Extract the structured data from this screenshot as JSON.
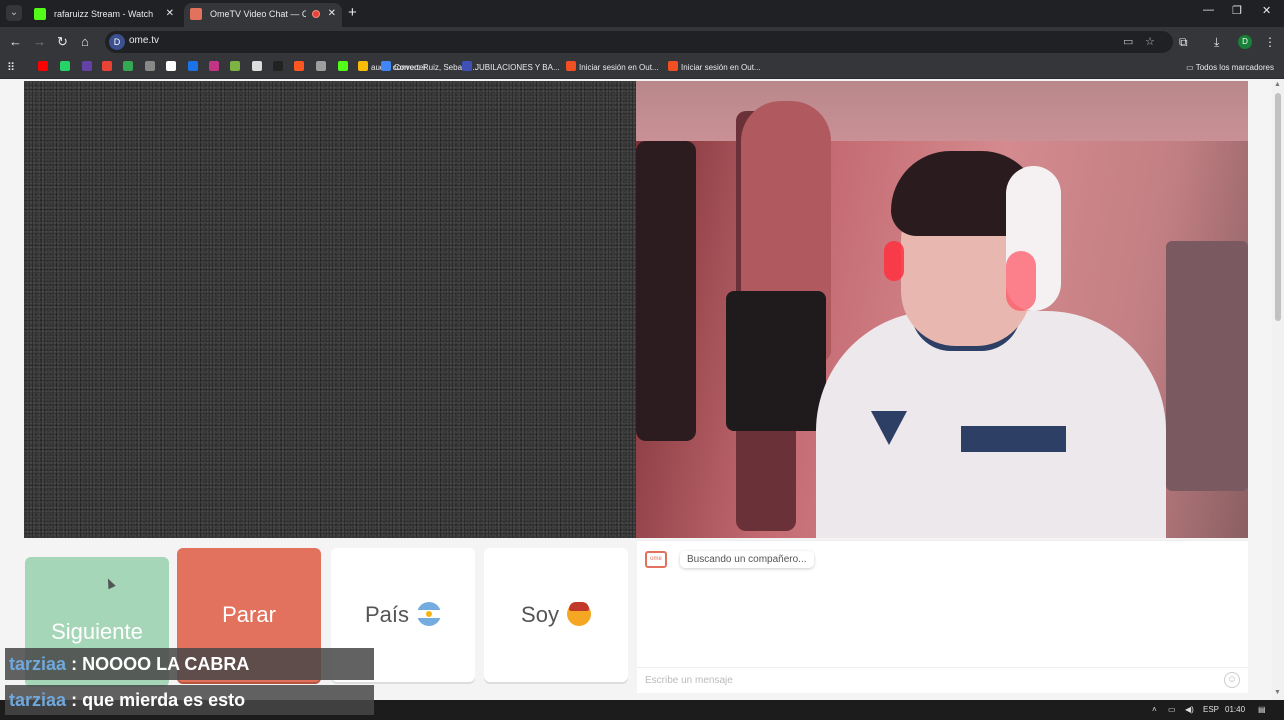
{
  "browser": {
    "tabs": [
      {
        "title": "rafaruizz Stream - Watch Live o",
        "favicon_color": "#53fc18",
        "active": false
      },
      {
        "title": "OmeTV Video Chat — Ome",
        "favicon_color": "#e2725e",
        "active": true
      }
    ],
    "url": "ome.tv",
    "site_badge": "D",
    "profile_initial": "D",
    "bookmarks": [
      {
        "label": "",
        "color": "#ff0000"
      },
      {
        "label": "",
        "color": "#25d366"
      },
      {
        "label": "",
        "color": "#6441a5"
      },
      {
        "label": "",
        "color": "#ea4335"
      },
      {
        "label": "",
        "color": "#34a853"
      },
      {
        "label": "",
        "color": "#888888"
      },
      {
        "label": "",
        "color": "#ffffff"
      },
      {
        "label": "",
        "color": "#1a73e8"
      },
      {
        "label": "",
        "color": "#c13584"
      },
      {
        "label": "",
        "color": "#7cb342"
      },
      {
        "label": "",
        "color": "#dddddd"
      },
      {
        "label": "",
        "color": "#222222"
      },
      {
        "label": "",
        "color": "#ff5722"
      },
      {
        "label": "",
        "color": "#9e9e9e"
      },
      {
        "label": "",
        "color": "#53fc18"
      },
      {
        "label": "audio converter",
        "color": "#fbbc05"
      },
      {
        "label": "Correo: Ruiz, Sebasti...",
        "color": "#4285f4"
      },
      {
        "label": "JUBILACIONES Y BA...",
        "color": "#3f51b5"
      },
      {
        "label": "Iniciar sesión en Out...",
        "color": "#f25022"
      },
      {
        "label": "Iniciar sesión en Out...",
        "color": "#f25022"
      }
    ],
    "all_bookmarks": "Todos los marcadores"
  },
  "ometv": {
    "buttons": {
      "next": "Siguiente",
      "stop": "Parar",
      "country": "País",
      "gender": "Soy"
    },
    "colors": {
      "next": "#a6d6b8",
      "stop": "#e2725e"
    },
    "chat": {
      "logo": "ome",
      "status": "Buscando un compañero...",
      "placeholder": "Escribe un mensaje"
    }
  },
  "stream_chat": [
    {
      "user": "tarziaa",
      "separator": ":",
      "text": "NOOOO LA CABRA"
    },
    {
      "user": "tarziaa",
      "separator": ":",
      "text": "que mierda es esto"
    }
  ],
  "taskbar": {
    "lang": "ESP",
    "time": "01:40"
  }
}
